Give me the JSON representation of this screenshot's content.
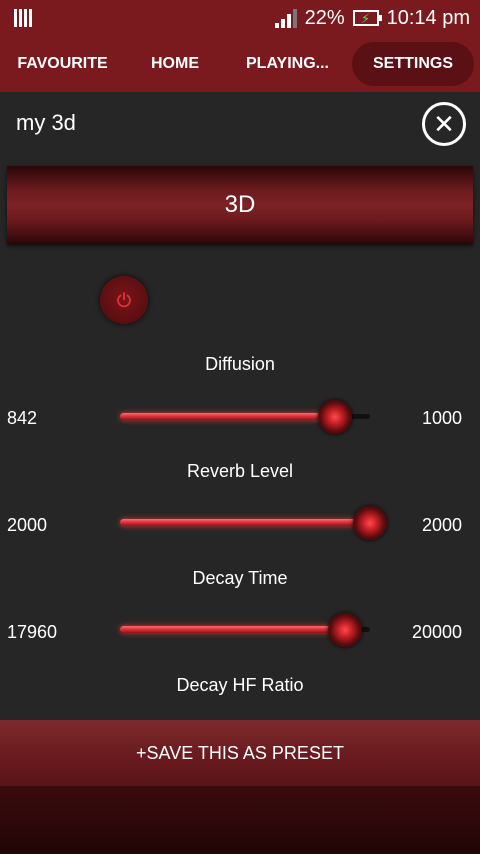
{
  "status_bar": {
    "battery_percent": "22%",
    "time": "10:14 pm",
    "icons": [
      "grid-icon",
      "signal-icon",
      "battery-charging-icon"
    ]
  },
  "tabs": [
    {
      "label": "FAVOURITE",
      "selected": false
    },
    {
      "label": "HOME",
      "selected": false
    },
    {
      "label": "PLAYING...",
      "selected": false
    },
    {
      "label": "SETTINGS",
      "selected": true
    }
  ],
  "preset": {
    "name": "my 3d",
    "close_icon": "close-circle-icon",
    "effect_label": "3D",
    "power_icon": "power-icon"
  },
  "params": [
    {
      "label": "Diffusion",
      "value": "842",
      "max": "1000",
      "fraction": 0.86
    },
    {
      "label": "Reverb Level",
      "value": "2000",
      "max": "2000",
      "fraction": 1.0
    },
    {
      "label": "Decay Time",
      "value": "17960",
      "max": "20000",
      "fraction": 0.9
    },
    {
      "label": "Decay HF Ratio"
    }
  ],
  "save_button": {
    "label": "+SAVE THIS AS PRESET"
  },
  "colors": {
    "accent": "#7a1a1e",
    "slider_glow": "#d8303a",
    "background": "#262626"
  }
}
